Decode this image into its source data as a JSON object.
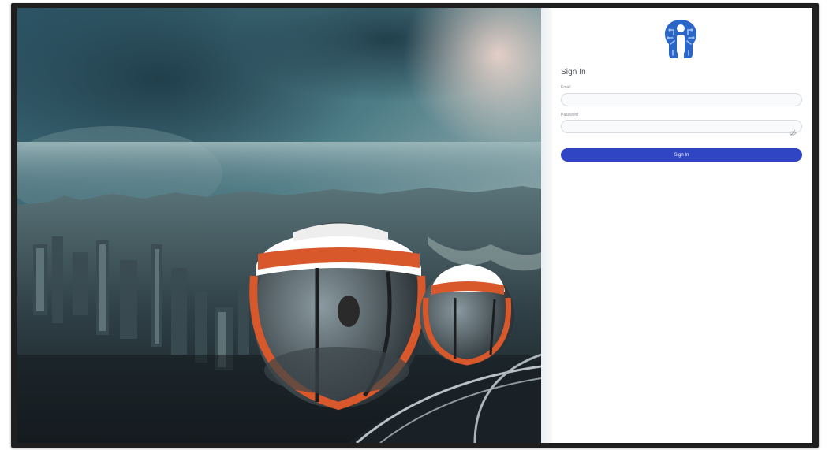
{
  "colors": {
    "primary": "#2f45c4",
    "logo": "#2a66c8",
    "frame": "#1f1f1f",
    "text": "#4a4f57",
    "muted": "#8a8f96"
  },
  "hero": {
    "image_description": "Aerial view of a hazy city skyline with orange and white observation wheel cabins in the foreground under a stormy teal sky"
  },
  "logo": {
    "icon": "brain-head-logo-icon"
  },
  "login": {
    "title": "Sign In",
    "email": {
      "label": "Email",
      "value": "",
      "placeholder": ""
    },
    "password": {
      "label": "Password",
      "value": "",
      "placeholder": "",
      "toggle_icon": "eye-off-icon"
    },
    "submit_label": "Sign In"
  }
}
